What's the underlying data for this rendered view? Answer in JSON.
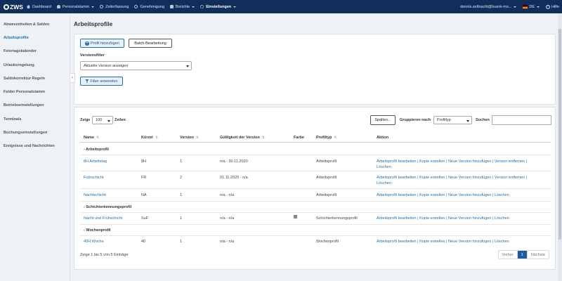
{
  "app": {
    "logo_text": "ZWS"
  },
  "nav": {
    "items": [
      {
        "label": "Dashboard"
      },
      {
        "label": "Personalstamm"
      },
      {
        "label": "Zeiterfassung"
      },
      {
        "label": "Genehmigung"
      },
      {
        "label": "Berichte"
      },
      {
        "label": "Einstellungen"
      }
    ],
    "user": "dennis.seltnacht@buerk-mo...",
    "lang": "DE",
    "help": "Hilfe"
  },
  "sidebar": {
    "items": [
      {
        "label": "Abwesenheiten & Salden"
      },
      {
        "label": "Arbeitsprofile"
      },
      {
        "label": "Feiertagskalender"
      },
      {
        "label": "Urlaubsregelung"
      },
      {
        "label": "Saldokorrektur Regeln"
      },
      {
        "label": "Felder Personalstamm"
      },
      {
        "label": "Betriebseinstellungen"
      },
      {
        "label": "Terminals"
      },
      {
        "label": "Buchungseinstellungen"
      },
      {
        "label": "Ereignisse und Nachrichten"
      }
    ]
  },
  "page": {
    "title": "Arbeitsprofile"
  },
  "toolbar": {
    "add_profile": "Profil hinzufügen",
    "batch_edit": "Batch-Bearbeitung",
    "version_filter_label": "Versionsfilter",
    "version_filter_value": "Aktuelle Version anzeigen",
    "apply_filter": "Filter anwenden"
  },
  "table_controls": {
    "show_label": "Zeige",
    "page_size": "100",
    "rows_label": "Zeilen",
    "columns_button": "Spalten...",
    "group_by_label": "Gruppieren nach",
    "group_by_value": "Profiltyp",
    "search_label": "Suchen"
  },
  "table": {
    "columns": [
      "Name",
      "Kürzel",
      "Version",
      "Gültigkeit der Version",
      "Farbe",
      "Profiltyp",
      "Aktion"
    ],
    "groups": [
      {
        "label": "- Arbeitsprofil",
        "rows": [
          {
            "name": "8H Arbeitstag",
            "short": "8H",
            "version": "1",
            "validity": "n/a - 30.11.2020",
            "type": "Arbeitsprofil",
            "actions": [
              "Arbeitsprofil bearbeiten",
              "Kopie erstellen",
              "Neue Version hinzufügen",
              "Version entfernen",
              "Löschen"
            ]
          },
          {
            "name": "Frühschicht",
            "short": "FR",
            "version": "2",
            "validity": "01.11.2020 - n/a",
            "type": "Arbeitsprofil",
            "actions": [
              "Arbeitsprofil bearbeiten",
              "Kopie erstellen",
              "Neue Version hinzufügen",
              "Version entfernen",
              "Löschen"
            ]
          },
          {
            "name": "Nachtschicht",
            "short": "NA",
            "version": "1",
            "validity": "n/a - n/a",
            "type": "Arbeitsprofil",
            "actions": [
              "Arbeitsprofil bearbeiten",
              "Kopie erstellen",
              "Neue Version hinzufügen",
              "Löschen"
            ]
          }
        ]
      },
      {
        "label": "- Schichterkennungsprofil",
        "rows": [
          {
            "name": "Nacht und Frühschicht",
            "short": "SuF",
            "version": "1",
            "validity": "n/a - n/a",
            "color": "#888888",
            "type": "Schichterkennungsprofil",
            "actions": [
              "Arbeitsprofil bearbeiten",
              "Kopie erstellen",
              "Neue Version hinzufügen",
              "Löschen"
            ]
          }
        ]
      },
      {
        "label": "- Wochenprofil",
        "rows": [
          {
            "name": "40H Woche",
            "short": "40",
            "version": "1",
            "validity": "n/a - n/a",
            "type": "Wochenprofil",
            "actions": [
              "Arbeitsprofil bearbeiten",
              "Kopie erstellen",
              "Neue Version hinzufügen",
              "Löschen"
            ]
          }
        ]
      }
    ]
  },
  "footer": {
    "info": "Zeige 1 bis 5 von 5 Einträge",
    "prev": "Vorher",
    "page": "1",
    "next": "Nächste"
  }
}
